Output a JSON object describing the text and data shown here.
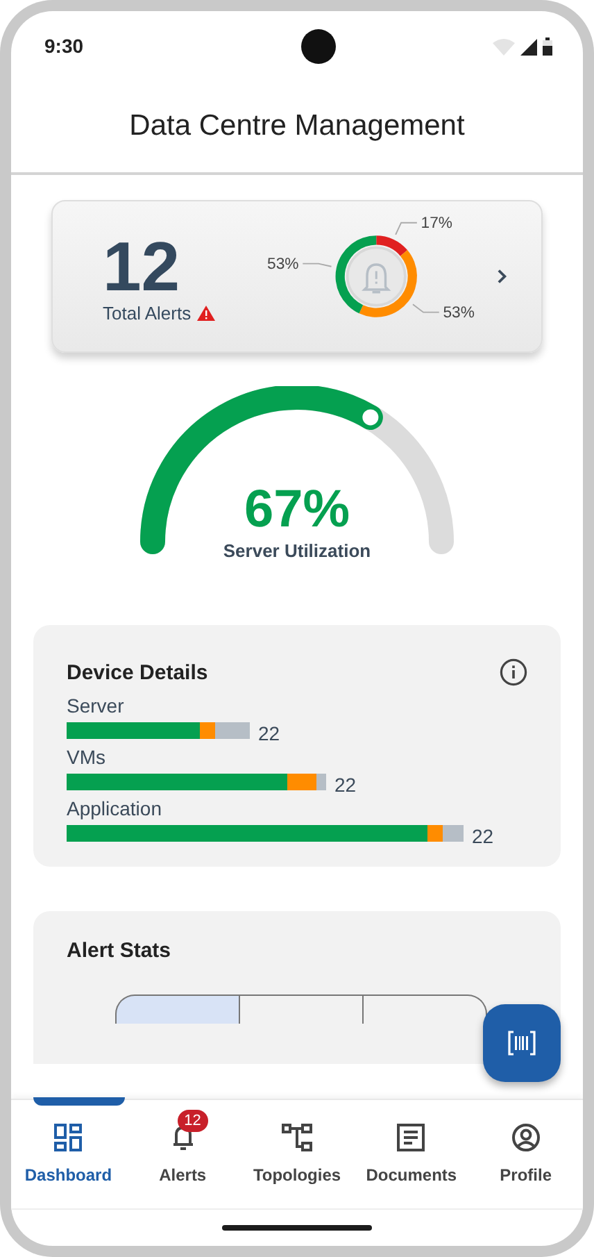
{
  "status_bar": {
    "time": "9:30"
  },
  "header": {
    "title": "Data Centre Management"
  },
  "alerts_card": {
    "count": "12",
    "label": "Total Alerts",
    "chart_data": {
      "type": "donut",
      "values": [
        17,
        53,
        53
      ],
      "colors": [
        "#e02020",
        "#ff8c00",
        "#05a050"
      ],
      "value_labels": [
        "17%",
        "53%",
        "53%"
      ]
    }
  },
  "gauge": {
    "value": "67%",
    "label": "Server Utilization"
  },
  "device_details": {
    "title": "Device Details",
    "devices": [
      {
        "name": "Server",
        "count": "22",
        "segments": [
          {
            "color": "#05a050"
          },
          {
            "color": "#ff8c00"
          },
          {
            "color": "#b6bec6"
          }
        ]
      },
      {
        "name": "VMs",
        "count": "22",
        "segments": [
          {
            "color": "#05a050"
          },
          {
            "color": "#ff8c00"
          },
          {
            "color": "#b6bec6"
          }
        ]
      },
      {
        "name": "Application",
        "count": "22",
        "segments": [
          {
            "color": "#05a050"
          },
          {
            "color": "#ff8c00"
          },
          {
            "color": "#b6bec6"
          }
        ]
      }
    ]
  },
  "alert_stats": {
    "title": "Alert Stats",
    "segments": [
      {
        "selected": true
      },
      {
        "selected": false
      },
      {
        "selected": false
      }
    ]
  },
  "nav": [
    {
      "kind": "dashboard",
      "label": "Dashboard",
      "selected": true
    },
    {
      "kind": "alerts",
      "label": "Alerts",
      "selected": false,
      "badge": "12"
    },
    {
      "kind": "topologies",
      "label": "Topologies",
      "selected": false
    },
    {
      "kind": "documents",
      "label": "Documents",
      "selected": false
    },
    {
      "kind": "profile",
      "label": "Profile",
      "selected": false
    }
  ]
}
